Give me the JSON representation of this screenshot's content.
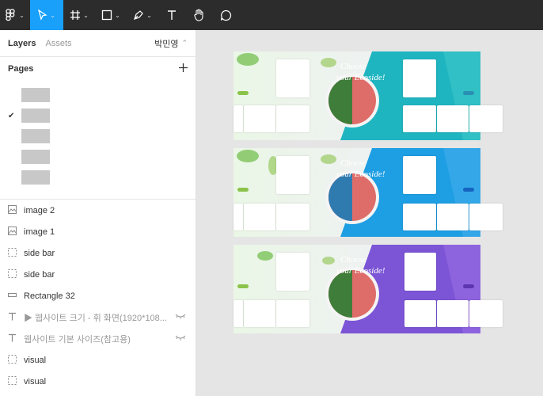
{
  "toolbar": {
    "tools": [
      "figma-menu-icon",
      "move-icon",
      "frame-icon",
      "shape-icon",
      "pen-icon",
      "text-icon",
      "hand-icon",
      "comment-icon"
    ]
  },
  "sidebar": {
    "tabs": {
      "layers": "Layers",
      "assets": "Assets"
    },
    "user_name": "박민영",
    "pages_title": "Pages",
    "layers": [
      {
        "icon": "image-icon",
        "label": "image 2"
      },
      {
        "icon": "image-icon",
        "label": "image 1"
      },
      {
        "icon": "frame-dashed-icon",
        "label": "side bar"
      },
      {
        "icon": "frame-dashed-icon",
        "label": "side bar"
      },
      {
        "icon": "rectangle-icon",
        "label": "Rectangle 32"
      },
      {
        "icon": "text-icon",
        "label": "▶ 웹사이트 크기 - 휘 화면(1920*108..."
      },
      {
        "icon": "text-icon",
        "label": "웹사이트 기본 사이즈(참고용)"
      },
      {
        "icon": "frame-dashed-icon",
        "label": "visual"
      },
      {
        "icon": "frame-dashed-icon",
        "label": "visual"
      }
    ]
  },
  "canvas": {
    "banner_text": "Choose your Ecoside!",
    "frames": [
      {
        "accent": "#1fb5c0",
        "accent2": "#35c3c5"
      },
      {
        "accent": "#1e9ee3",
        "accent2": "#3aa9e8"
      },
      {
        "accent": "#7b55d6",
        "accent2": "#9267e0"
      }
    ]
  }
}
